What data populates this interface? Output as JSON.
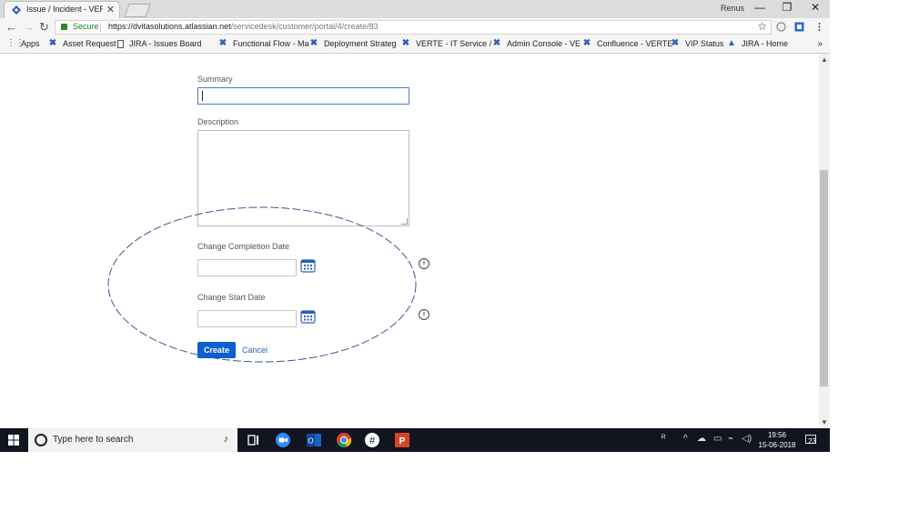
{
  "browser": {
    "tab_title": "Issue / Incident - VERT - I",
    "tab_close": "✕",
    "profile_name": "Renus",
    "window_controls": [
      "—",
      "❐",
      "✕"
    ],
    "nav": {
      "back": "←",
      "forward": "→",
      "reload": "↻"
    },
    "address": {
      "secure_label": "Secure",
      "host": "https://dvitasolutions.atlassian.net",
      "path": "/servicedesk/customer/portal/4/create/83"
    },
    "bookmarks": [
      {
        "label": "Apps",
        "icon": "apps-grid-icon"
      },
      {
        "label": "Asset Request",
        "icon": "jira-x-icon"
      },
      {
        "label": "JIRA - Issues Board",
        "icon": "document-icon"
      },
      {
        "label": "Functional Flow - Ma",
        "icon": "jira-x-icon"
      },
      {
        "label": "Deployment Strateg",
        "icon": "jira-x-icon"
      },
      {
        "label": "VERTE - IT Service /",
        "icon": "confluence-icon"
      },
      {
        "label": "Admin Console - VE",
        "icon": "confluence-icon"
      },
      {
        "label": "Confluence - VERTE",
        "icon": "jira-x-icon"
      },
      {
        "label": "VIP Status",
        "icon": "jira-x-icon"
      },
      {
        "label": "JIRA - Home",
        "icon": "jira-home-icon"
      }
    ],
    "bookmarks_more": "»"
  },
  "form": {
    "summary_label": "Summary",
    "summary_value": "",
    "description_label": "Description",
    "description_value": "",
    "completion_date_label": "Change Completion Date",
    "start_date_label": "Change Start Date",
    "info_glyph": "i",
    "create_label": "Create",
    "cancel_label": "Cancel"
  },
  "taskbar": {
    "search_placeholder": "Type here to search",
    "mic": "🎤",
    "time": "19:56",
    "date": "15-06-2018",
    "notification_count": "23",
    "tray": [
      "ᴿ",
      "^",
      "☁",
      "▭",
      "◁)",
      "⌁"
    ]
  },
  "colors": {
    "primary_button": "#0b5fd0",
    "focus_border": "#4a7fc9",
    "link": "#2b5fb7",
    "annotation_ellipse": "#3a5a8c",
    "taskbar": "#101520"
  }
}
